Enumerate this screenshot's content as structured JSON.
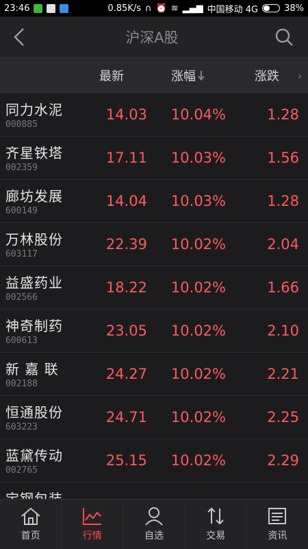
{
  "status": {
    "time": "23:46",
    "speed": "0.85K/s",
    "carrier": "中国移动 4G",
    "battery": "38%"
  },
  "nav": {
    "title": "沪深A股"
  },
  "columns": {
    "newest": "最新",
    "pct": "涨幅",
    "change": "涨跌",
    "more": "›"
  },
  "stocks": [
    {
      "name": "同力水泥",
      "code": "000885",
      "price": "14.03",
      "pct": "10.04%",
      "change": "1.28"
    },
    {
      "name": "齐星铁塔",
      "code": "002359",
      "price": "17.11",
      "pct": "10.03%",
      "change": "1.56"
    },
    {
      "name": "廊坊发展",
      "code": "600149",
      "price": "14.04",
      "pct": "10.03%",
      "change": "1.28"
    },
    {
      "name": "万林股份",
      "code": "603117",
      "price": "22.39",
      "pct": "10.02%",
      "change": "2.04"
    },
    {
      "name": "益盛药业",
      "code": "002566",
      "price": "18.22",
      "pct": "10.02%",
      "change": "1.66"
    },
    {
      "name": "神奇制药",
      "code": "600613",
      "price": "23.05",
      "pct": "10.02%",
      "change": "2.10"
    },
    {
      "name": "新 嘉 联",
      "code": "002188",
      "price": "24.27",
      "pct": "10.02%",
      "change": "2.21"
    },
    {
      "name": "恒通股份",
      "code": "603223",
      "price": "24.71",
      "pct": "10.02%",
      "change": "2.25"
    },
    {
      "name": "蓝黛传动",
      "code": "002765",
      "price": "25.15",
      "pct": "10.02%",
      "change": "2.29"
    },
    {
      "name": "宝钢包装",
      "code": "",
      "price": "",
      "pct": "",
      "change": ""
    }
  ],
  "tabs": [
    {
      "label": "首页",
      "icon": "home-icon"
    },
    {
      "label": "行情",
      "icon": "market-chart-icon"
    },
    {
      "label": "自选",
      "icon": "watchlist-person-icon"
    },
    {
      "label": "交易",
      "icon": "trade-arrows-icon"
    },
    {
      "label": "资讯",
      "icon": "news-icon"
    }
  ],
  "colors": {
    "accent": "#ff4a4a",
    "up": "#ff5a5a",
    "background": "#1c1c1e"
  }
}
